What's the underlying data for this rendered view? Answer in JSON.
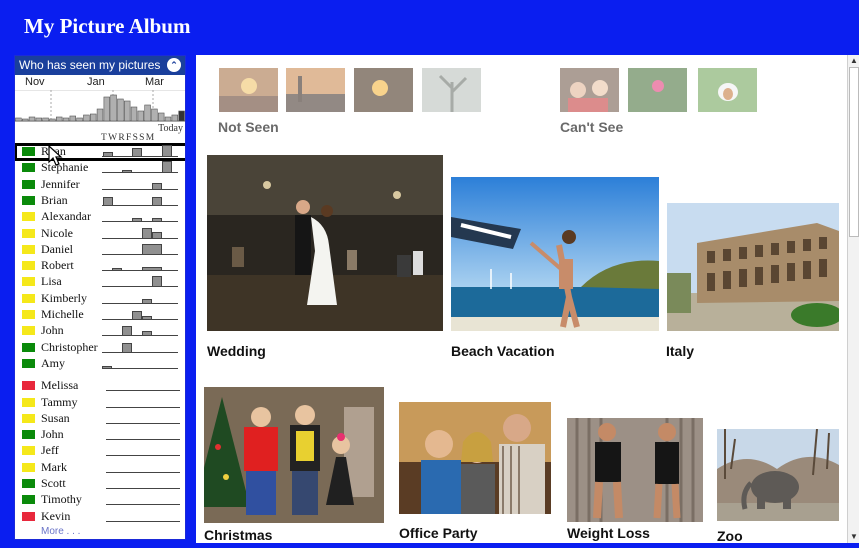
{
  "app": {
    "title": "My Picture Album"
  },
  "sidebar": {
    "header": "Who has seen my pictures",
    "months": [
      "Nov",
      "Jan",
      "Mar"
    ],
    "today_label": "Today",
    "days_label": "TWRFSSM",
    "more_label": "More . . .",
    "people": [
      {
        "name": "Ryan",
        "status": "green",
        "selected": true
      },
      {
        "name": "Stephanie",
        "status": "green"
      },
      {
        "name": "Jennifer",
        "status": "green"
      },
      {
        "name": "Brian",
        "status": "green"
      },
      {
        "name": "Alexandar",
        "status": "yellow"
      },
      {
        "name": "Nicole",
        "status": "yellow"
      },
      {
        "name": "Daniel",
        "status": "yellow"
      },
      {
        "name": "Robert",
        "status": "yellow"
      },
      {
        "name": "Lisa",
        "status": "yellow"
      },
      {
        "name": "Kimberly",
        "status": "yellow"
      },
      {
        "name": "Michelle",
        "status": "yellow"
      },
      {
        "name": "John",
        "status": "yellow"
      },
      {
        "name": "Christopher",
        "status": "green"
      },
      {
        "name": "Amy",
        "status": "green"
      },
      {
        "name": "Melissa",
        "status": "red"
      },
      {
        "name": "Tammy",
        "status": "yellow"
      },
      {
        "name": "Susan",
        "status": "yellow"
      },
      {
        "name": "John",
        "status": "green"
      },
      {
        "name": "Jeff",
        "status": "yellow"
      },
      {
        "name": "Mark",
        "status": "yellow"
      },
      {
        "name": "Scott",
        "status": "green"
      },
      {
        "name": "Timothy",
        "status": "green"
      },
      {
        "name": "Kevin",
        "status": "red"
      }
    ]
  },
  "groups": {
    "not_seen": "Not Seen",
    "cant_see": "Can't See"
  },
  "albums": [
    {
      "name": "Wedding"
    },
    {
      "name": "Beach Vacation"
    },
    {
      "name": "Italy"
    },
    {
      "name": "Christmas"
    },
    {
      "name": "Office Party"
    },
    {
      "name": "Weight Loss"
    },
    {
      "name": "Zoo"
    }
  ],
  "colors": {
    "frame": "#0a1ef0",
    "sidebar_header": "#1a3f9c",
    "green": "#0a8a0a",
    "yellow": "#f5e81a",
    "red": "#e8283c"
  },
  "icons": [
    "collapse-up-icon",
    "mouse-pointer-icon",
    "scroll-up-icon",
    "scroll-down-icon"
  ]
}
